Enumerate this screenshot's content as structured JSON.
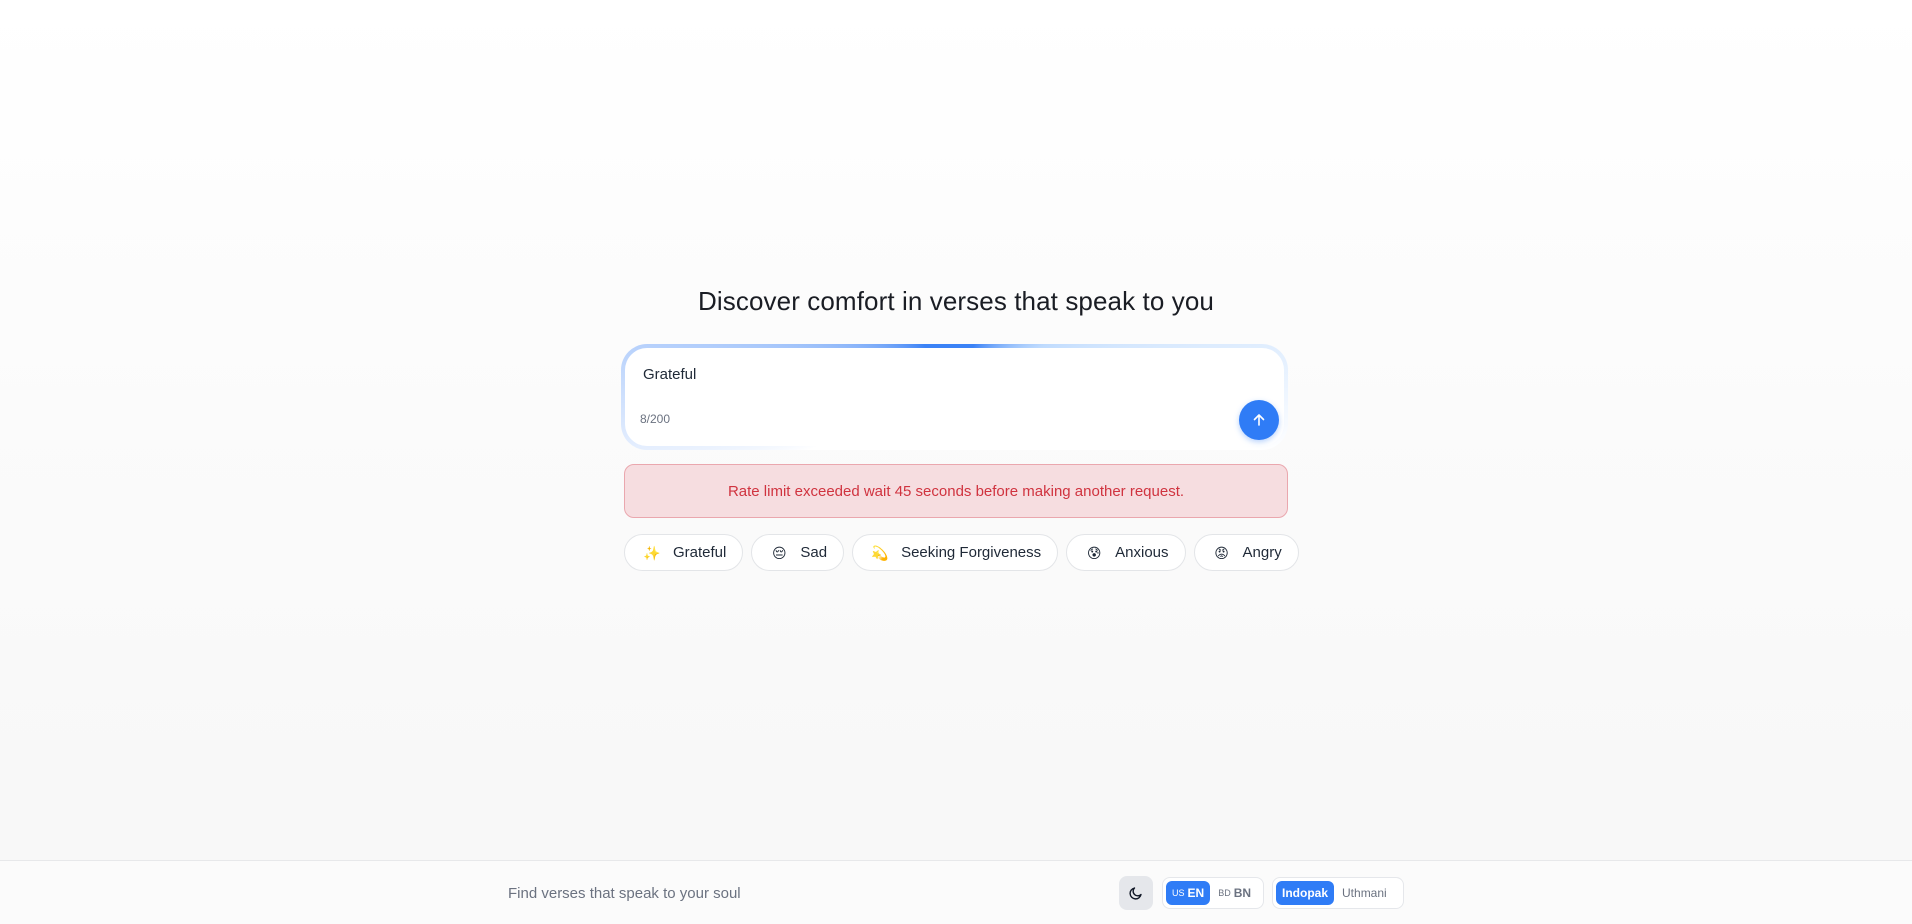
{
  "main": {
    "title": "Discover comfort in verses that speak to you",
    "search": {
      "value": "Grateful",
      "char_count": "8/200"
    },
    "alert": "Rate limit exceeded wait 45 seconds before making another request.",
    "moods": [
      {
        "label": "Grateful",
        "icon": "sparkles-icon",
        "emoji": "✨"
      },
      {
        "label": "Sad",
        "icon": "sad-face-icon",
        "emoji": "😔"
      },
      {
        "label": "Seeking Forgiveness",
        "icon": "dizzy-star-icon",
        "emoji": "💫"
      },
      {
        "label": "Anxious",
        "icon": "anxious-face-icon",
        "emoji": "😰"
      },
      {
        "label": "Angry",
        "icon": "angry-face-icon",
        "emoji": "😡"
      }
    ]
  },
  "footer": {
    "tagline": "Find verses that speak to your soul",
    "theme_icon": "moon-icon",
    "language": {
      "options": [
        {
          "flag": "US",
          "label": "EN",
          "active": true
        },
        {
          "flag": "BD",
          "label": "BN",
          "active": false
        }
      ]
    },
    "script": {
      "options": [
        {
          "label": "Indopak",
          "active": true
        },
        {
          "label": "Uthmani",
          "active": false
        }
      ]
    }
  },
  "colors": {
    "accent": "#2f7cf6",
    "alert_bg": "#f6dde0",
    "alert_text": "#d0333f",
    "alert_border": "#eaa7ae"
  }
}
